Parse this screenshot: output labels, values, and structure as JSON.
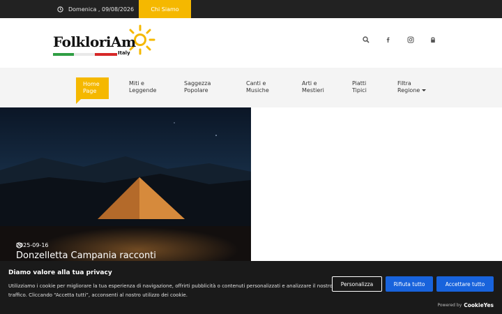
{
  "topbar": {
    "date": "Domenica , 09/08/2026",
    "chi_siamo": "Chi Siamo"
  },
  "logo": {
    "text": "FolkloriAm",
    "sub": "Italy"
  },
  "header_icons": [
    "search-icon",
    "facebook-icon",
    "instagram-icon",
    "lock-icon"
  ],
  "nav": {
    "items": [
      {
        "label": "Home Page"
      },
      {
        "label": "Miti e Leggende"
      },
      {
        "label": "Saggezza Popolare"
      },
      {
        "label": "Canti e Musiche"
      },
      {
        "label": "Arti e Mestieri"
      },
      {
        "label": "Piatti Tipici"
      },
      {
        "label": "Filtra Regione"
      }
    ]
  },
  "hero": {
    "date": "2025-09-16",
    "title": "Donzelletta Campania racconti"
  },
  "cookie": {
    "title": "Diamo valore alla tua privacy",
    "text": "Utilizziamo i cookie per migliorare la tua esperienza di navigazione, offrirti pubblicità o contenuti personalizzati e analizzare il nostro traffico. Cliccando “Accetta tutti”, acconsenti al nostro utilizzo dei cookie.",
    "customize": "Personalizza",
    "reject": "Rifiuta tutto",
    "accept": "Accettare tutto",
    "powered_by": "Powered by",
    "brand": "CookieYes"
  },
  "colors": {
    "accent": "#f5b800",
    "topbar": "#222222",
    "cookie_button": "#1863dc"
  }
}
